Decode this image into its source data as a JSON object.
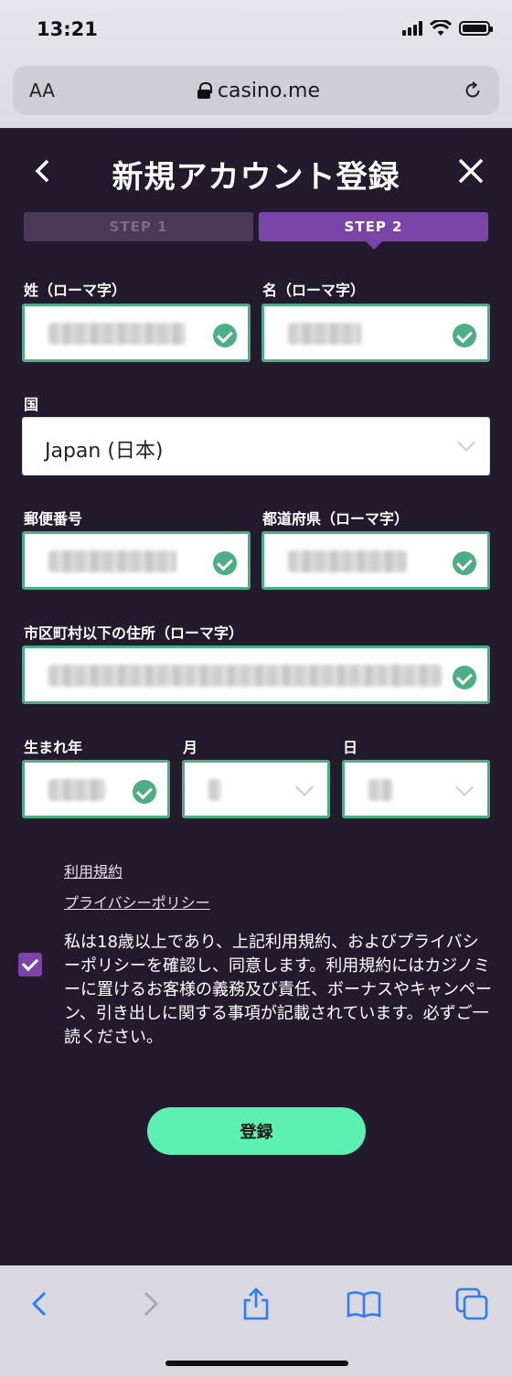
{
  "status_bar": {
    "time": "13:21"
  },
  "browser": {
    "aa_label": "AA",
    "url": "casino.me"
  },
  "header": {
    "title": "新規アカウント登録"
  },
  "steps": [
    {
      "label": "STEP 1"
    },
    {
      "label": "STEP 2"
    }
  ],
  "form": {
    "last_name_label": "姓（ローマ字）",
    "first_name_label": "名（ローマ字）",
    "country_label": "国",
    "country_value": "Japan (日本)",
    "postal_label": "郵便番号",
    "prefecture_label": "都道府県（ローマ字）",
    "address_label": "市区町村以下の住所（ローマ字）",
    "birth_year_label": "生まれ年",
    "birth_month_label": "月",
    "birth_day_label": "日"
  },
  "links": {
    "terms": "利用規約",
    "privacy": "プライバシーポリシー"
  },
  "agreement": {
    "text": "私は18歳以上であり、上記利用規約、およびプライバシーポリシーを確認し、同意します。利用規約にはカジノミーに置けるお客様の義務及び責任、ボーナスやキャンペーン、引き出しに関する事項が記載されています。必ずご一読ください。"
  },
  "submit": {
    "label": "登録"
  },
  "colors": {
    "accent": "#7b44a8",
    "valid": "#4caf84",
    "button": "#5df0b3",
    "background": "#241a2e"
  }
}
